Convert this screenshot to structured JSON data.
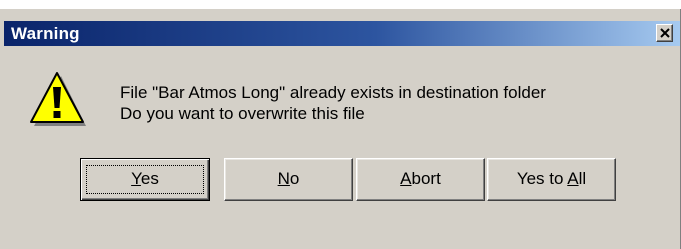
{
  "window": {
    "title": "Warning",
    "close_glyph": "✕",
    "background_color": "#d4d0c8",
    "titlebar_color": "#0a246a"
  },
  "icon": {
    "name": "warning-icon",
    "color": "#ffff00"
  },
  "message": {
    "line1": "File \"Bar Atmos Long\" already exists in destination folder",
    "line2": "Do you want to overwrite this file"
  },
  "buttons": {
    "yes": {
      "pre": "",
      "key": "Y",
      "post": "es"
    },
    "no": {
      "pre": "",
      "key": "N",
      "post": "o"
    },
    "abort": {
      "pre": "",
      "key": "A",
      "post": "bort"
    },
    "yes_to_all": {
      "pre": "Yes to ",
      "key": "A",
      "post": "ll"
    }
  }
}
